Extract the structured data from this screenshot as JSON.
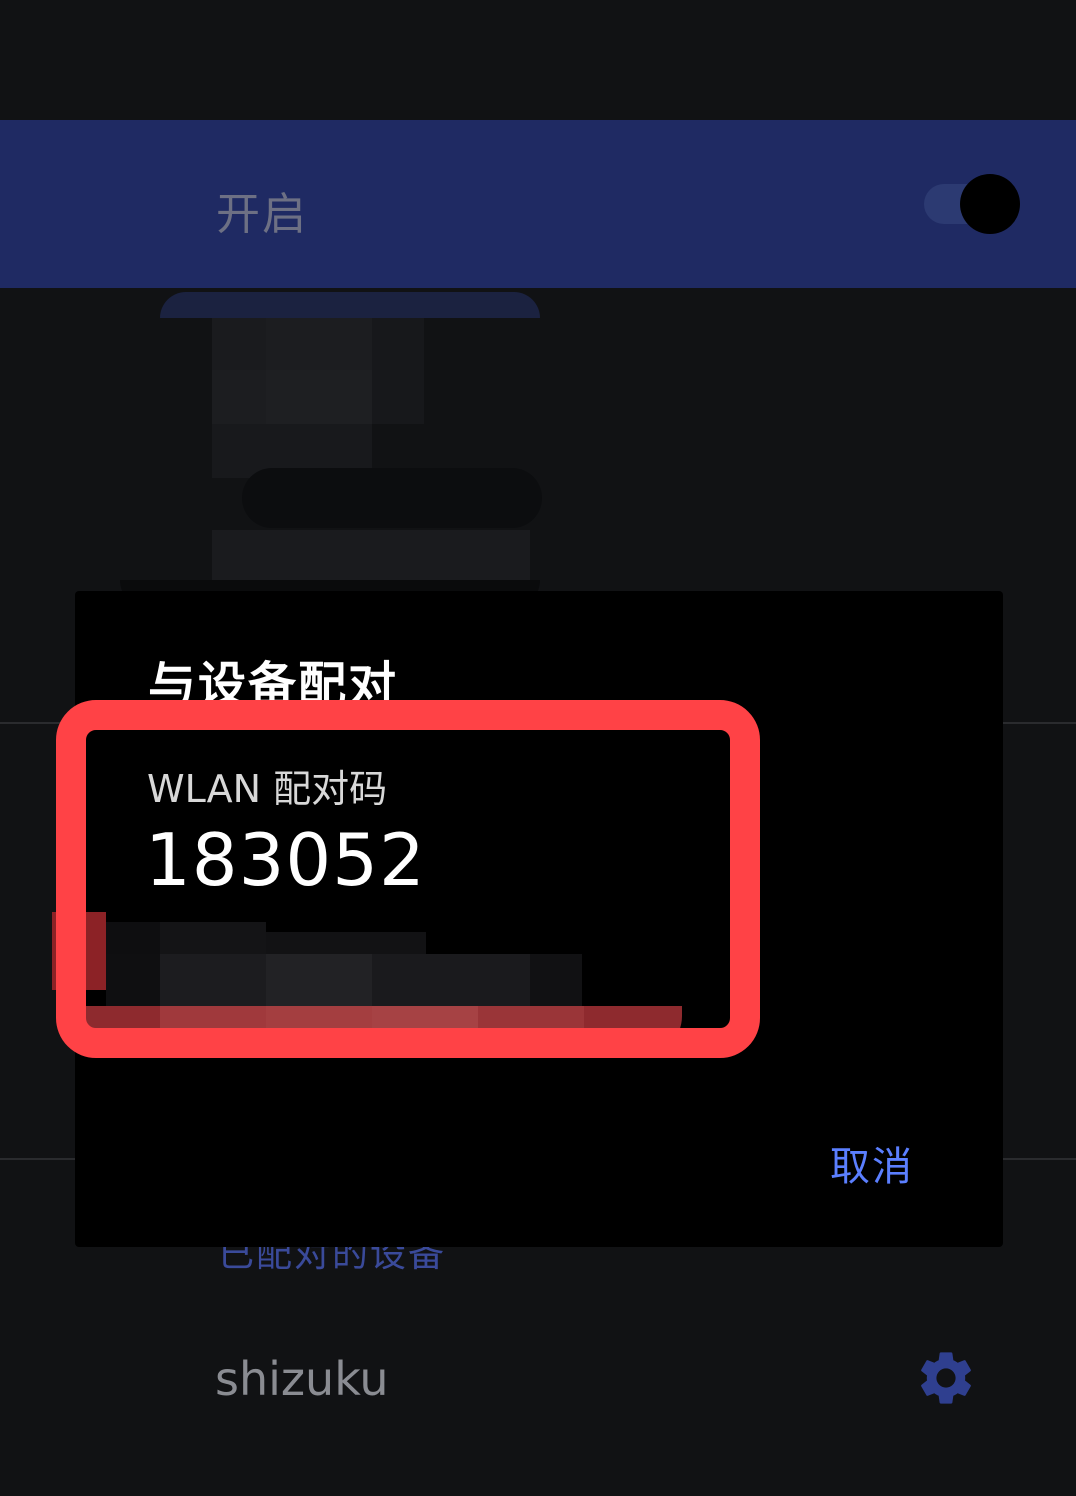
{
  "enable_bar": {
    "label": "开启",
    "toggle_on": true
  },
  "dialog": {
    "title": "与设备配对",
    "pairing_code_label": "WLAN 配对码",
    "pairing_code": "183052",
    "cancel_label": "取消"
  },
  "paired_devices": {
    "header": "已配对的设备",
    "items": [
      {
        "name": "shizuku",
        "action_icon": "gear-icon"
      }
    ]
  },
  "colors": {
    "accent": "#5b7fff",
    "enable_bar_bg": "#1f2a63",
    "annotation_red": "#ff4246"
  }
}
